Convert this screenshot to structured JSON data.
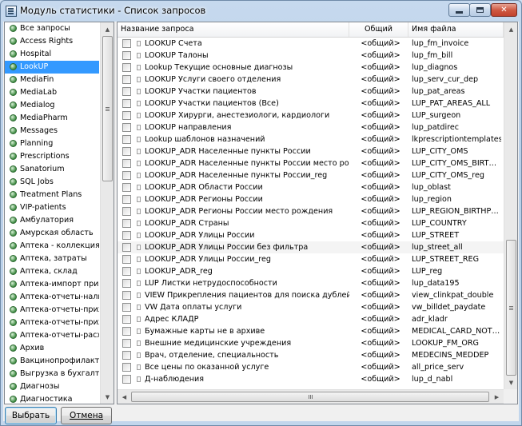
{
  "window": {
    "title": "Модуль статистики - Список запросов"
  },
  "left_list": {
    "items": [
      {
        "label": "Все запросы",
        "selected": false
      },
      {
        "label": "Access Rights",
        "selected": false
      },
      {
        "label": "Hospital",
        "selected": false
      },
      {
        "label": "LookUP",
        "selected": true
      },
      {
        "label": "MediaFin",
        "selected": false
      },
      {
        "label": "MediaLab",
        "selected": false
      },
      {
        "label": "Medialog",
        "selected": false
      },
      {
        "label": "MediaPharm",
        "selected": false
      },
      {
        "label": "Messages",
        "selected": false
      },
      {
        "label": "Planning",
        "selected": false
      },
      {
        "label": "Prescriptions",
        "selected": false
      },
      {
        "label": "Sanatorium",
        "selected": false
      },
      {
        "label": "SQL Jobs",
        "selected": false
      },
      {
        "label": "Treatment Plans",
        "selected": false
      },
      {
        "label": "VIP-patients",
        "selected": false
      },
      {
        "label": "Амбулатория",
        "selected": false
      },
      {
        "label": "Амурская область",
        "selected": false
      },
      {
        "label": "Аптека - коллекция",
        "selected": false
      },
      {
        "label": "Аптека, затраты",
        "selected": false
      },
      {
        "label": "Аптека, склад",
        "selected": false
      },
      {
        "label": "Аптека-импорт прихо…",
        "selected": false
      },
      {
        "label": "Аптека-отчеты-налич…",
        "selected": false
      },
      {
        "label": "Аптека-отчеты-прихо…",
        "selected": false
      },
      {
        "label": "Аптека-отчеты-прихо…",
        "selected": false
      },
      {
        "label": "Аптека-отчеты-расхо…",
        "selected": false
      },
      {
        "label": "Архив",
        "selected": false
      },
      {
        "label": "Вакцинопрофилактика",
        "selected": false
      },
      {
        "label": "Выгрузка в бухгалтер…",
        "selected": false
      },
      {
        "label": "Диагнозы",
        "selected": false
      },
      {
        "label": "Диагностика",
        "selected": false
      }
    ]
  },
  "grid": {
    "columns": {
      "name": "Название запроса",
      "general": "Общий",
      "file": "Имя файла"
    },
    "rows": [
      {
        "name": "LOOKUP Счета",
        "general": "<общий>",
        "file": "lup_fm_invoice",
        "highlight": false
      },
      {
        "name": "LOOKUP Талоны",
        "general": "<общий>",
        "file": "lup_fm_bill",
        "highlight": false
      },
      {
        "name": "Lookup Текущие основные диагнозы",
        "general": "<общий>",
        "file": "lup_diagnos",
        "highlight": false
      },
      {
        "name": "LOOKUP Услуги своего отделения",
        "general": "<общий>",
        "file": "lup_serv_cur_dep",
        "highlight": false
      },
      {
        "name": "LOOKUP Участки пациентов",
        "general": "<общий>",
        "file": "lup_pat_areas",
        "highlight": false
      },
      {
        "name": "LOOKUP Участки пациентов (Все)",
        "general": "<общий>",
        "file": "LUP_PAT_AREAS_ALL",
        "highlight": false
      },
      {
        "name": "LOOKUP Хирурги, анестезиологи, кардиологи",
        "general": "<общий>",
        "file": "LUP_surgeon",
        "highlight": false
      },
      {
        "name": "LOOKUP направления",
        "general": "<общий>",
        "file": "lup_patdirec",
        "highlight": false
      },
      {
        "name": "Lookup шаблонов назначений",
        "general": "<общий>",
        "file": "lkprescriptiontemplates",
        "highlight": false
      },
      {
        "name": "LOOKUP_ADR Населенные пункты России",
        "general": "<общий>",
        "file": "LUP_CITY_OMS",
        "highlight": false
      },
      {
        "name": "LOOKUP_ADR Населенные пункты России место рожд…",
        "general": "<общий>",
        "file": "LUP_CITY_OMS_BIRT…",
        "highlight": false
      },
      {
        "name": "LOOKUP_ADR Населенные пункты России_reg",
        "general": "<общий>",
        "file": "LUP_CITY_OMS_reg",
        "highlight": false
      },
      {
        "name": "LOOKUP_ADR Области России",
        "general": "<общий>",
        "file": "lup_oblast",
        "highlight": false
      },
      {
        "name": "LOOKUP_ADR Регионы России",
        "general": "<общий>",
        "file": "lup_region",
        "highlight": false
      },
      {
        "name": "LOOKUP_ADR Регионы России место рождения",
        "general": "<общий>",
        "file": "LUP_REGION_BIRTHP…",
        "highlight": false
      },
      {
        "name": "LOOKUP_ADR Страны",
        "general": "<общий>",
        "file": "LUP_COUNTRY",
        "highlight": false
      },
      {
        "name": "LOOKUP_ADR Улицы России",
        "general": "<общий>",
        "file": "LUP_STREET",
        "highlight": false
      },
      {
        "name": "LOOKUP_ADR Улицы России без фильтра",
        "general": "<общий>",
        "file": "lup_street_all",
        "highlight": true
      },
      {
        "name": "LOOKUP_ADR Улицы России_reg",
        "general": "<общий>",
        "file": "LUP_STREET_REG",
        "highlight": false
      },
      {
        "name": "LOOKUP_ADR_reg",
        "general": "<общий>",
        "file": "LUP_reg",
        "highlight": false
      },
      {
        "name": "LUP Листки нетрудоспособности",
        "general": "<общий>",
        "file": "lup_data195",
        "highlight": false
      },
      {
        "name": "VIEW Прикрепления пациентов для поиска дублей",
        "general": "<общий>",
        "file": "view_clinkpat_double",
        "highlight": false
      },
      {
        "name": "VW Дата оплаты услуги",
        "general": "<общий>",
        "file": "vw_billdet_paydate",
        "highlight": false
      },
      {
        "name": "Адрес КЛАДР",
        "general": "<общий>",
        "file": "adr_kladr",
        "highlight": false
      },
      {
        "name": "Бумажные карты не в архиве",
        "general": "<общий>",
        "file": "MEDICAL_CARD_NOT…",
        "highlight": false
      },
      {
        "name": "Внешние медицинские учреждения",
        "general": "<общий>",
        "file": "LOOKUP_FM_ORG",
        "highlight": false
      },
      {
        "name": "Врач, отделение, специальность",
        "general": "<общий>",
        "file": "MEDECINS_MEDDEP",
        "highlight": false
      },
      {
        "name": "Все цены по оказанной услуге",
        "general": "<общий>",
        "file": "all_price_serv",
        "highlight": false
      },
      {
        "name": "Д-наблюдения",
        "general": "<общий>",
        "file": "lup_d_nabl",
        "highlight": false
      }
    ]
  },
  "buttons": {
    "ok": "Выбрать",
    "cancel": "Отмена"
  }
}
